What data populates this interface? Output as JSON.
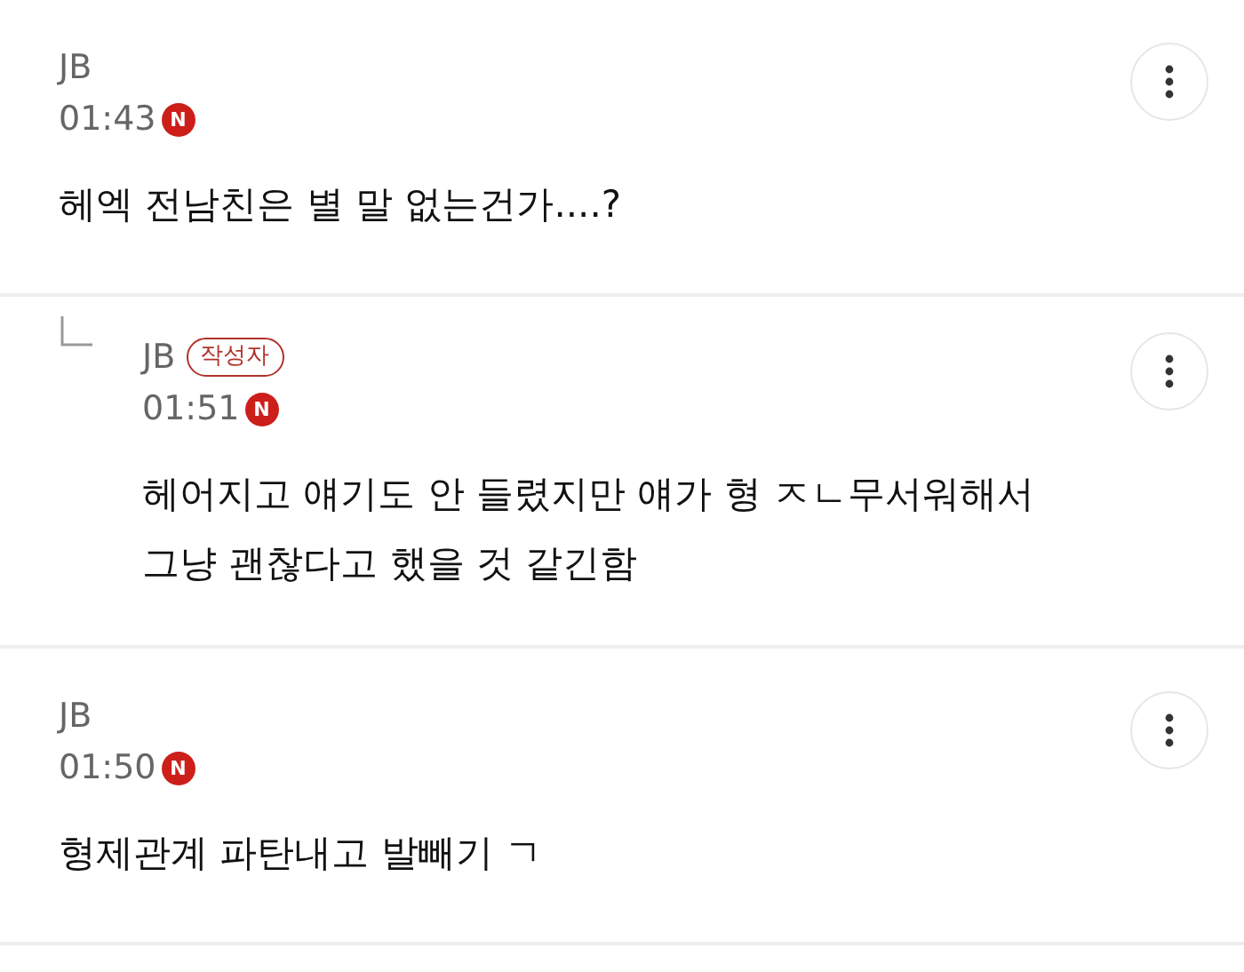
{
  "comments": [
    {
      "kind": "comment",
      "author": "JB",
      "time": "01:43",
      "new_badge": "N",
      "body": "헤엑 전남친은 별 말 없는건가....?"
    },
    {
      "kind": "reply",
      "author": "JB",
      "author_badge": "작성자",
      "time": "01:51",
      "new_badge": "N",
      "body": "헤어지고 얘기도 안 들렸지만 얘가 형 ㅈㄴ무서워해서\n그냥 괜찮다고 했을 것 같긴함"
    },
    {
      "kind": "comment",
      "author": "JB",
      "time": "01:50",
      "new_badge": "N",
      "body": "형제관계 파탄내고 발빼기 ㄱ"
    }
  ]
}
